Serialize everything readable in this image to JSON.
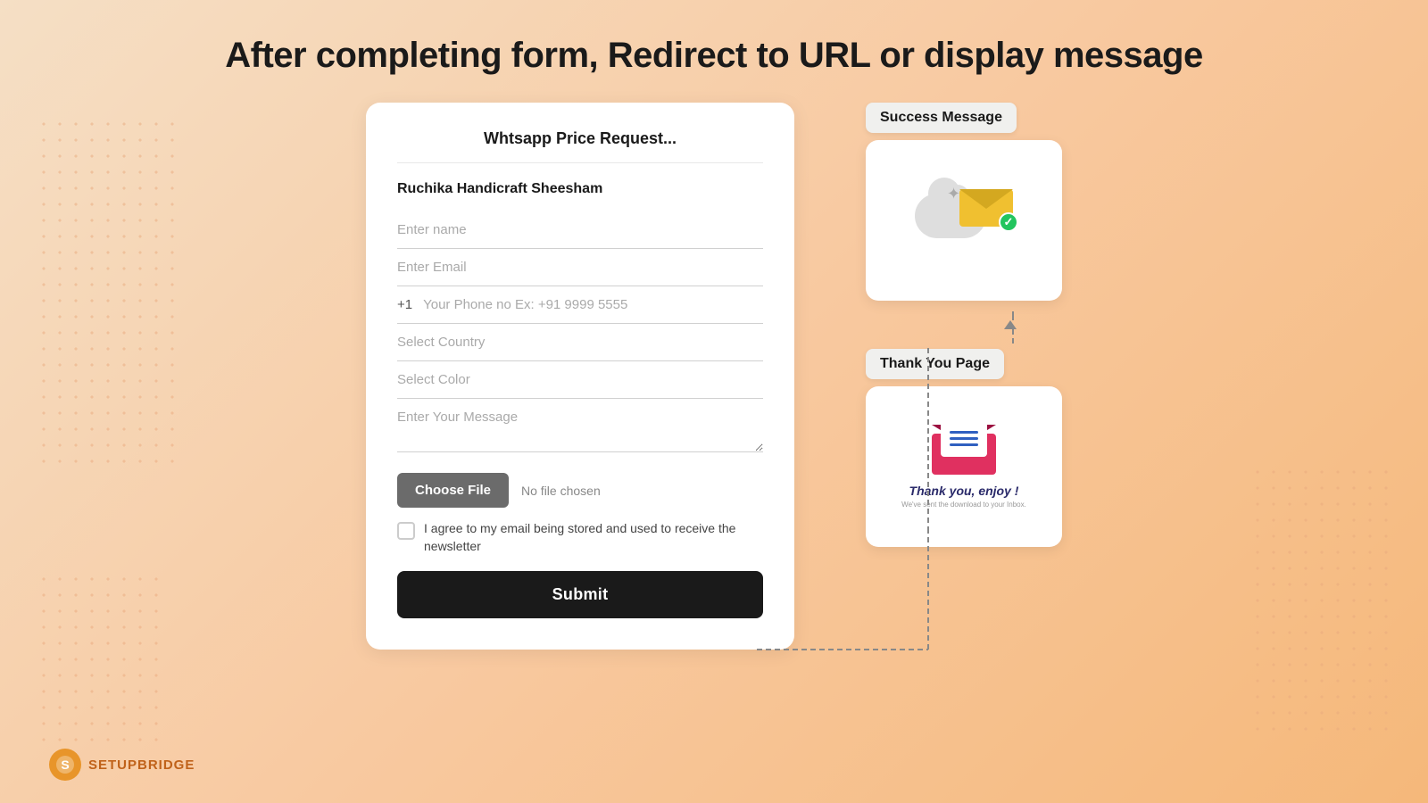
{
  "page": {
    "title": "After completing form, Redirect to URL or display message",
    "background_color": "#f8c9a0"
  },
  "form": {
    "title": "Whtsapp Price Request...",
    "shop_name": "Ruchika Handicraft Sheesham",
    "fields": {
      "name_placeholder": "Enter name",
      "email_placeholder": "Enter Email",
      "phone_prefix": "+1",
      "phone_placeholder": "Your Phone no Ex: +91 9999 5555",
      "country_placeholder": "Select Country",
      "color_placeholder": "Select Color",
      "message_placeholder": "Enter Your Message"
    },
    "file": {
      "choose_label": "Choose File",
      "no_file_text": "No file chosen"
    },
    "checkbox_label": "I agree to my email being stored and used to receive the newsletter",
    "submit_label": "Submit"
  },
  "flow": {
    "success_label": "Success Message",
    "thankyou_label": "Thank You Page"
  },
  "logo": {
    "text": "SETUPBRIDGE"
  }
}
